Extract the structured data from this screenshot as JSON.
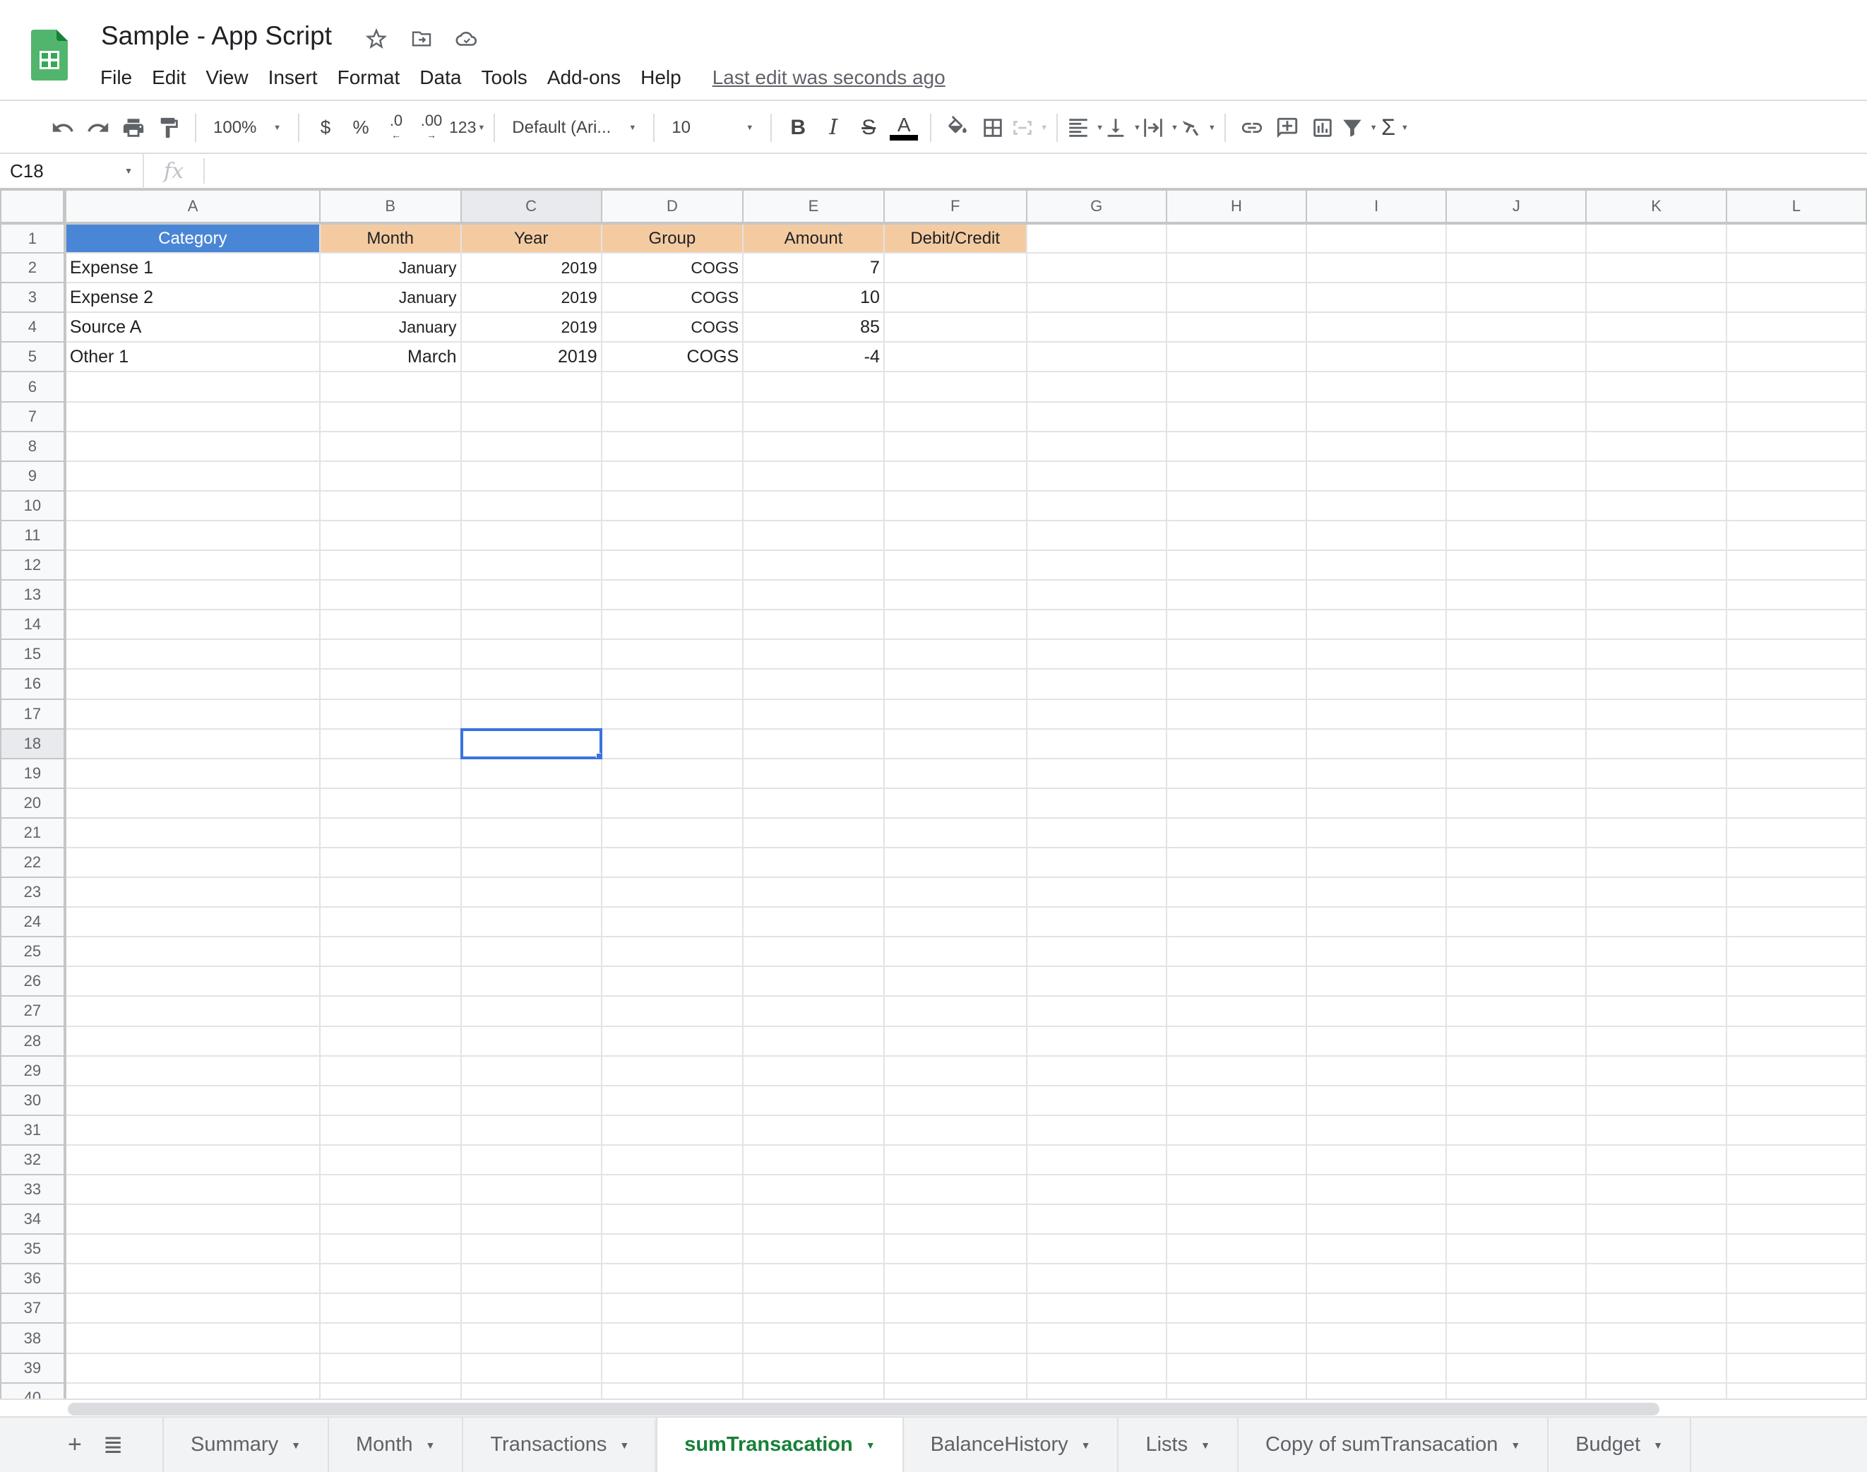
{
  "app": {
    "title": "Sample - App Script",
    "menu": [
      "File",
      "Edit",
      "View",
      "Insert",
      "Format",
      "Data",
      "Tools",
      "Add-ons",
      "Help"
    ],
    "last_edit": "Last edit was seconds ago"
  },
  "toolbar": {
    "zoom": "100%",
    "currency": "$",
    "percent": "%",
    "decrease_decimal": ".0",
    "increase_decimal": ".00",
    "more_formats": "123",
    "font": "Default (Ari...",
    "font_size": "10",
    "bold": "B",
    "italic": "I",
    "strikethrough": "S",
    "text_color": "A",
    "function": "Σ"
  },
  "formula_bar": {
    "name_box": "C18",
    "fx": "fx",
    "value": ""
  },
  "grid": {
    "columns": [
      "A",
      "B",
      "C",
      "D",
      "E",
      "F",
      "G",
      "H",
      "I",
      "J",
      "K",
      "L"
    ],
    "selected_column": "C",
    "selected_row": 18,
    "header_row": [
      "Category",
      "Month",
      "Year",
      "Group",
      "Amount",
      "Debit/Credit"
    ],
    "rows": [
      [
        "Expense 1",
        "January",
        "2019",
        "COGS",
        "7",
        ""
      ],
      [
        "Expense 2",
        "January",
        "2019",
        "COGS",
        "10",
        ""
      ],
      [
        "Source A",
        "January",
        "2019",
        "COGS",
        "85",
        ""
      ],
      [
        "Other 1",
        "March",
        "2019",
        "COGS",
        "-4",
        ""
      ]
    ],
    "row_count_visible": 40,
    "colors": {
      "category_header": "#4a86d6",
      "other_headers": "#f4cba1",
      "selection": "#3a73e0"
    }
  },
  "sheets": {
    "add_label": "+",
    "list_label": "≣",
    "tabs": [
      "Summary",
      "Month",
      "Transactions",
      "sumTransacation",
      "BalanceHistory",
      "Lists",
      "Copy of sumTransacation",
      "Budget"
    ],
    "active": "sumTransacation",
    "active_color": "#188038"
  }
}
